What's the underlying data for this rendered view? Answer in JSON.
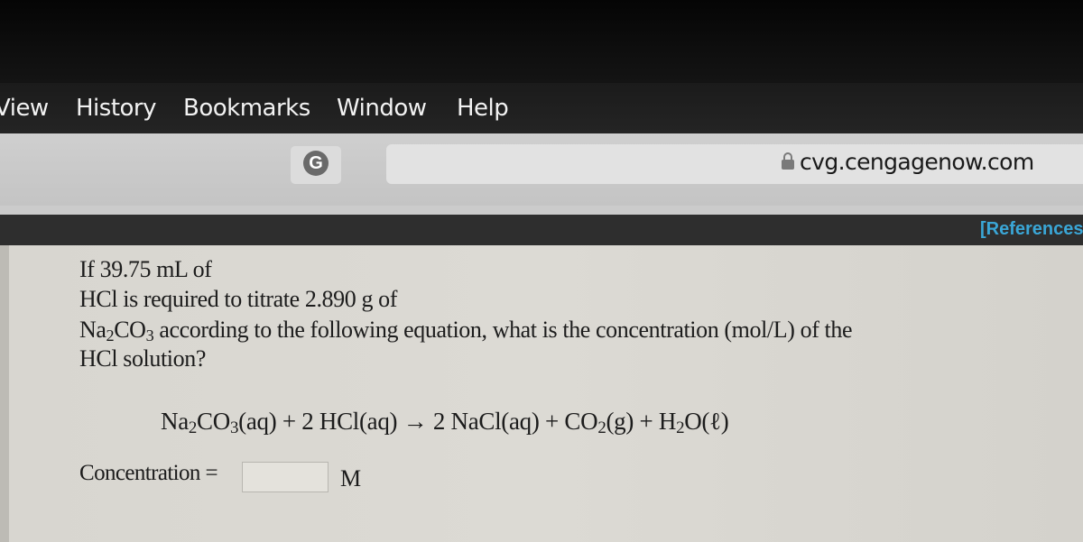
{
  "menubar": {
    "items": [
      "View",
      "History",
      "Bookmarks",
      "Window",
      "Help"
    ]
  },
  "toolbar": {
    "grammarly_icon": "G",
    "url": "cvg.cengagenow.com",
    "lock_icon": "lock-icon"
  },
  "header": {
    "references_link": "[References]"
  },
  "question": {
    "line1": "If 39.75 mL of",
    "line2": "HCl is required to titrate 2.890 g of",
    "line3_formula": "Na2CO3",
    "line3_rest": " according to the following equation, what is the concentration (mol/L) of the",
    "line4": "HCl solution?",
    "volume_mL": "39.75",
    "mass_g": "2.890"
  },
  "equation": {
    "text": "Na2CO3(aq) + 2 HCl(aq) → 2 NaCl(aq) + CO2(g) + H2O(ℓ)"
  },
  "answer": {
    "label": "Concentration =",
    "value": "",
    "unit": "M"
  }
}
